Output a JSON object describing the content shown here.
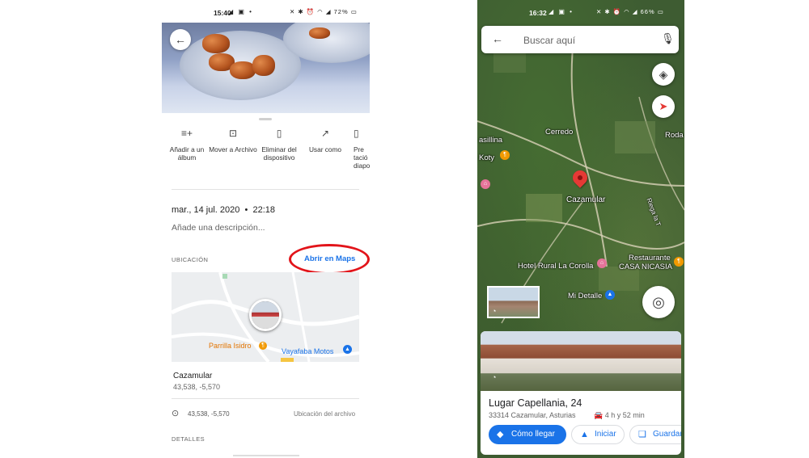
{
  "photos": {
    "status": {
      "time": "15:40",
      "battery": "72%"
    },
    "actions": [
      {
        "label": "Añadir a un álbum",
        "icon": "add-to-album-icon"
      },
      {
        "label": "Mover a Archivo",
        "icon": "archive-icon"
      },
      {
        "label": "Eliminar del dispositivo",
        "icon": "delete-from-device-icon"
      },
      {
        "label": "Usar como",
        "icon": "open-in-icon"
      },
      {
        "label": "Pre tació diapo",
        "icon": "slideshow-icon"
      }
    ],
    "date": "mar., 14 jul. 2020",
    "time": "22:18",
    "description_placeholder": "Añade una descripción...",
    "location_header": "UBICACIÓN",
    "open_in_maps": "Abrir en Maps",
    "map": {
      "poi_1": "Parrilla Isidro",
      "poi_2": "Vayafaba Motos"
    },
    "place_name": "Cazamular",
    "coordinates": "43,538, -5,570",
    "file_location_label": "Ubicación del archivo",
    "details_header": "DETALLES",
    "accent_color": "#1a73e8",
    "highlight_color": "#e2141a"
  },
  "maps": {
    "status": {
      "time": "16:32",
      "battery": "66%"
    },
    "search_placeholder": "Buscar aquí",
    "labels": {
      "cerredo": "Cerredo",
      "asillina": "asillina",
      "koty": "Koty",
      "roda": "Roda",
      "cazamular": "Cazamular",
      "restaurante": "Restaurante",
      "casa_nicasia": "CASA NICASIA",
      "hotel": "Hotel Rural La Corolla",
      "mi_detalle": "Mi Detalle",
      "riega": "Riega la T"
    },
    "card": {
      "title": "Lugar Capellania, 24",
      "address": "33314 Cazamular, Asturias",
      "duration": "4 h y 52 min",
      "buttons": {
        "directions": "Cómo llegar",
        "start": "Iniciar",
        "save": "Guardar"
      }
    },
    "pin_color": "#e53935"
  }
}
